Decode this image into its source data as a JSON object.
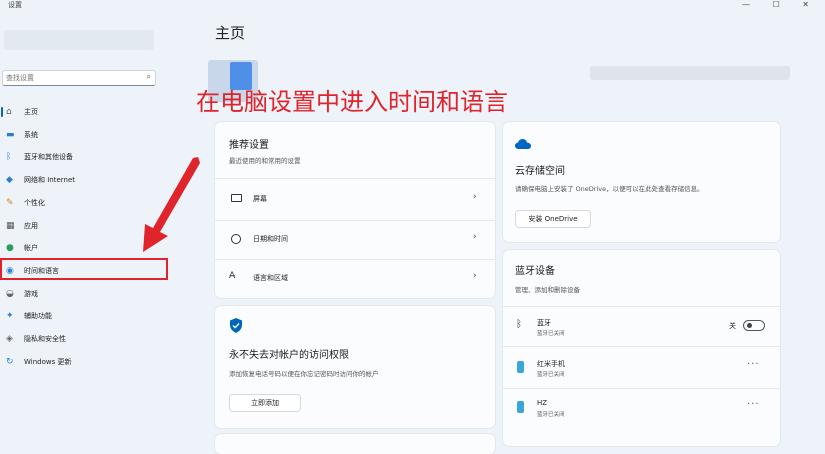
{
  "app": {
    "title": "设置",
    "window_controls": "— ☐ ✕"
  },
  "page": {
    "title": "主页"
  },
  "search": {
    "placeholder": "查找设置"
  },
  "sidebar": {
    "items": [
      {
        "label": "主页",
        "icon": "home-icon"
      },
      {
        "label": "系统",
        "icon": "monitor-icon"
      },
      {
        "label": "蓝牙和其他设备",
        "icon": "bluetooth-icon"
      },
      {
        "label": "网络和 Internet",
        "icon": "wifi-icon"
      },
      {
        "label": "个性化",
        "icon": "brush-icon"
      },
      {
        "label": "应用",
        "icon": "apps-icon"
      },
      {
        "label": "帐户",
        "icon": "person-icon"
      },
      {
        "label": "时间和语言",
        "icon": "globe-clock-icon"
      },
      {
        "label": "游戏",
        "icon": "gamepad-icon"
      },
      {
        "label": "辅助功能",
        "icon": "accessibility-icon"
      },
      {
        "label": "隐私和安全性",
        "icon": "shield-icon"
      },
      {
        "label": "Windows 更新",
        "icon": "update-icon"
      }
    ]
  },
  "annotation": {
    "text": "在电脑设置中进入时间和语言"
  },
  "recommended": {
    "title": "推荐设置",
    "subtitle": "最近使用的和常用的设置",
    "rows": [
      {
        "label": "屏幕",
        "icon": "display-icon"
      },
      {
        "label": "日期和时间",
        "icon": "clock-icon"
      },
      {
        "label": "语言和区域",
        "icon": "language-icon"
      }
    ]
  },
  "cloud": {
    "title": "云存储空间",
    "description": "请确保电脑上安装了 OneDrive，以便可以在此处查看存储信息。",
    "button": "安装 OneDrive"
  },
  "account": {
    "title": "永不失去对帐户的访问权限",
    "description": "添加恢复电话号码以便在你忘记密码时访问你的帐户",
    "button": "立即添加"
  },
  "bluetooth": {
    "title": "蓝牙设备",
    "subtitle": "管理、添加和删除设备",
    "toggle": {
      "label": "蓝牙",
      "sub": "蓝牙已关闭",
      "state_label": "关",
      "on": false
    },
    "devices": [
      {
        "name": "红米手机",
        "status": "蓝牙已关闭"
      },
      {
        "name": "HZ",
        "status": "蓝牙已关闭"
      }
    ],
    "more_label": "···"
  },
  "colors": {
    "accent": "#0067c0",
    "annotation": "#e0242b",
    "device": "#3aa7d8"
  }
}
